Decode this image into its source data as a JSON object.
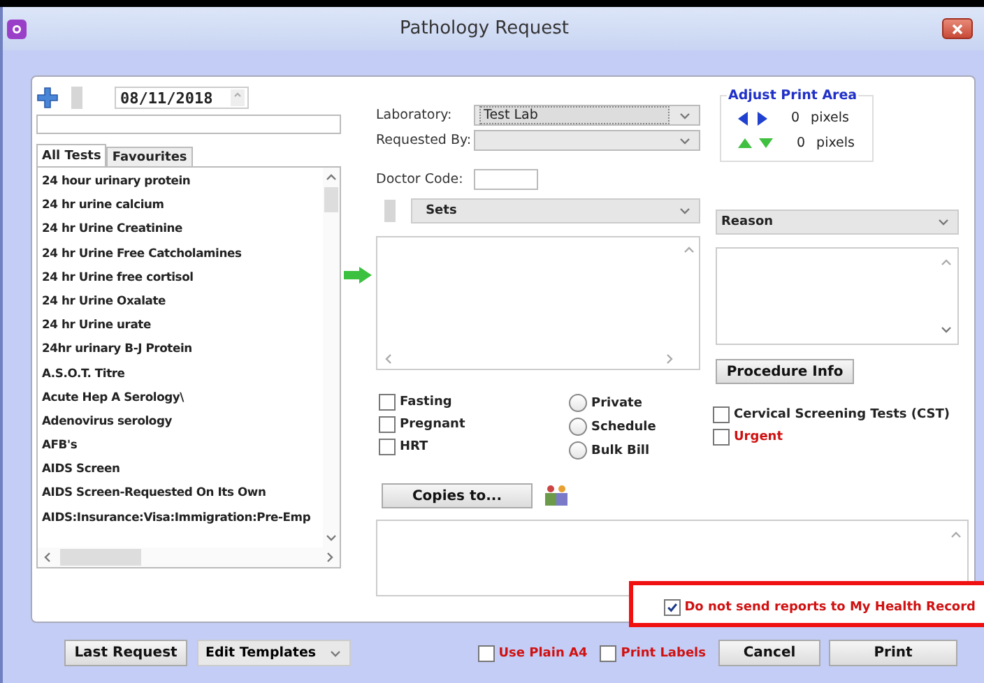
{
  "window": {
    "title": "Pathology Request"
  },
  "date": "08/11/2018",
  "test_tabs": [
    {
      "label": "All Tests",
      "selected": true
    },
    {
      "label": "Favourites",
      "selected": false
    }
  ],
  "tests": [
    "24 hour urinary protein",
    "24 hr urine calcium",
    "24 hr Urine Creatinine",
    "24 hr Urine Free Catcholamines",
    "24 hr Urine free cortisol",
    "24 hr Urine Oxalate",
    "24 hr Urine urate",
    "24hr urinary B-J Protein",
    "A.S.O.T. Titre",
    "Acute Hep A Serology\\",
    "Adenovirus serology",
    "AFB's",
    "AIDS Screen",
    "AIDS Screen-Requested On Its Own",
    "AIDS:Insurance:Visa:Immigration:Pre-Emp"
  ],
  "laboratory": {
    "label": "Laboratory:",
    "value": "Test Lab"
  },
  "requested_by": {
    "label": "Requested By:"
  },
  "doctor_code": {
    "label": "Doctor Code:"
  },
  "sets": {
    "value": "Sets"
  },
  "reason": {
    "value": "Reason"
  },
  "adjust_print_area": {
    "title": "Adjust Print Area",
    "horizontal": {
      "value": "0",
      "unit": "pixels"
    },
    "vertical": {
      "value": "0",
      "unit": "pixels"
    }
  },
  "procedure_info": "Procedure Info",
  "flags": [
    {
      "label": "Fasting",
      "checked": false
    },
    {
      "label": "Pregnant",
      "checked": false
    },
    {
      "label": "HRT",
      "checked": false
    }
  ],
  "billing": [
    {
      "label": "Private",
      "selected": false
    },
    {
      "label": "Schedule",
      "selected": false
    },
    {
      "label": "Bulk Bill",
      "selected": false
    }
  ],
  "extra_flags": [
    {
      "label": "Cervical Screening Tests (CST)",
      "checked": false,
      "kind": "plain"
    },
    {
      "label": "Urgent",
      "checked": false,
      "kind": "alert"
    }
  ],
  "copies_button": "Copies to...",
  "mhr_option": {
    "label": "Do not send reports to My Health Record",
    "checked": true
  },
  "footer": {
    "last_request": "Last Request",
    "edit_templates": "Edit Templates",
    "options": [
      {
        "label": "Use Plain A4",
        "checked": false
      },
      {
        "label": "Print Labels",
        "checked": false
      }
    ],
    "buttons": [
      "Cancel",
      "Print"
    ]
  }
}
